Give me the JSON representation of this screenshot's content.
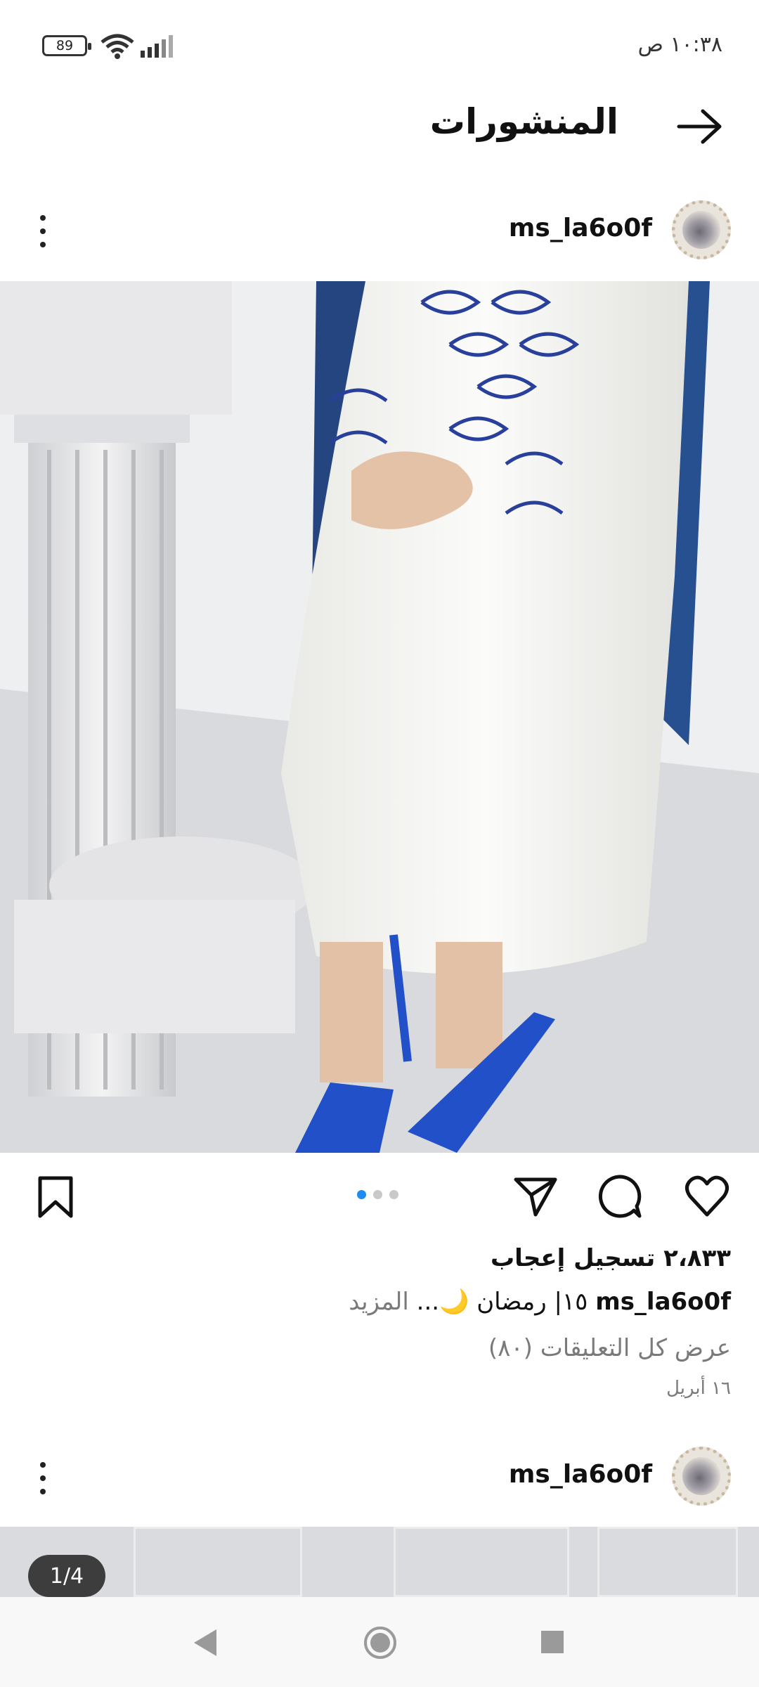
{
  "status_bar": {
    "time": "١٠:٣٨ ص",
    "battery": "89"
  },
  "header": {
    "title": "المنشورات"
  },
  "post1": {
    "username": "ms_la6o0f",
    "likes": "٢،٨٣٣ تسجيل إعجاب",
    "caption_username": "ms_la6o0f",
    "caption_text": "١٥| رمضان 🌙...",
    "caption_more": "المزيد",
    "view_comments": "عرض كل التعليقات (٨٠)",
    "date": "١٦ أبريل",
    "carousel": {
      "count": 3,
      "active": 0
    }
  },
  "post2": {
    "username": "ms_la6o0f",
    "image_counter": "1/4"
  },
  "colors": {
    "accent": "#1d8bf1",
    "text": "#111111",
    "muted": "#7a7a7a"
  },
  "icons": [
    "back-arrow-icon",
    "kebab-icon",
    "heart-icon",
    "comment-icon",
    "share-icon",
    "bookmark-icon",
    "nav-back-icon",
    "nav-home-icon",
    "nav-recents-icon"
  ]
}
